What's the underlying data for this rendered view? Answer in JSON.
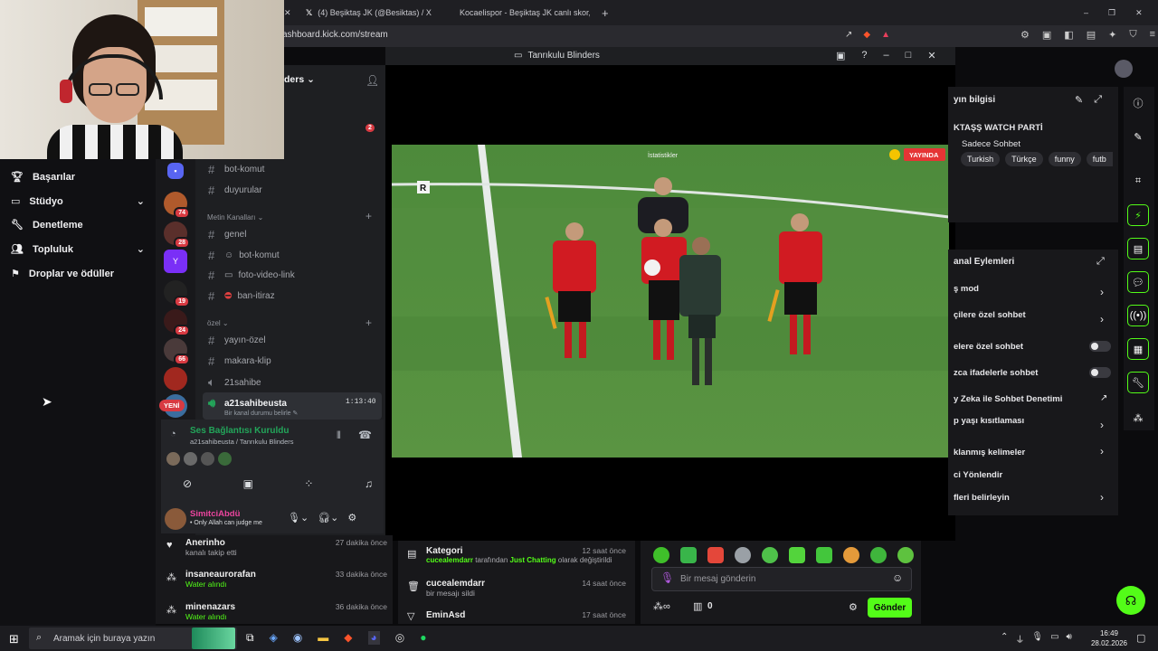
{
  "browser": {
    "tabs": [
      "(4) Beşiktaş JK (@Besiktas) / X",
      "Kocaelispor - Beşiktaş JK canlı skor, b"
    ],
    "url": "ashboard.kick.com/stream"
  },
  "kick_nav": [
    {
      "label": "Başarılar",
      "icon": "trophy-icon"
    },
    {
      "label": "Stüdyo",
      "icon": "studio-icon",
      "chevron": true
    },
    {
      "label": "Denetleme",
      "icon": "wrench-icon"
    },
    {
      "label": "Topluluk",
      "icon": "people-icon",
      "chevron": true
    },
    {
      "label": "Droplar ve ödüller",
      "icon": "rewards-icon"
    }
  ],
  "discord": {
    "server_title": "ders",
    "mention_badge": "2",
    "guild_badges": [
      "74",
      "28",
      "19",
      "24",
      "66"
    ],
    "new_label": "YENİ",
    "top_channels": [
      "bot-komut",
      "duyurular"
    ],
    "text_category": "Metin Kanalları",
    "text_channels": [
      "genel",
      "bot-komut",
      "foto-video-link",
      "ban-itiraz"
    ],
    "private_category": "özel",
    "private_channels": [
      "yayın-özel",
      "makara-klip",
      "21sahibe"
    ],
    "voice_channel": {
      "name": "a21sahibeusta",
      "time": "1:13:40",
      "status": "Bir kanal durumu belirle"
    },
    "voice_connected": "Ses Bağlantısı Kuruldu",
    "voice_path": "a21sahibeusta / Tanrıkulu Blinders",
    "user": {
      "name": "SimitciAbdü",
      "status": "Only Allah can judge me"
    }
  },
  "video": {
    "window_title": "Tanrıkulu Blinders",
    "live_label": "YAYINDA",
    "overlay_text": "İstatistikler",
    "r_logo": "R"
  },
  "stream_info": {
    "heading": "yın bilgisi",
    "title": "KTAŞŞ WATCH PARTİ",
    "chat_mode": "Sadece Sohbet",
    "tags": [
      "Turkish",
      "Türkçe",
      "funny",
      "futb"
    ]
  },
  "channel_actions": {
    "heading": "anal Eylemleri",
    "rows": [
      {
        "label": "ş mod",
        "control": "chevron"
      },
      {
        "label": "çilere özel sohbet",
        "control": "chevron"
      },
      {
        "label": "elere özel sohbet",
        "control": "toggle"
      },
      {
        "label": "zca ifadelerle sohbet",
        "control": "toggle"
      },
      {
        "label": "y Zeka ile Sohbet Denetimi",
        "control": "external"
      },
      {
        "label": "p yaşı kısıtlaması",
        "control": "chevron"
      },
      {
        "label": "klanmış kelimeler",
        "control": "chevron"
      },
      {
        "label": "ci Yönlendir",
        "control": "none"
      },
      {
        "label": "fleri belirleyin",
        "control": "chevron"
      }
    ]
  },
  "activity_feed": [
    {
      "name": "Anerinho",
      "desc": "kanalı takip etti",
      "time": "27 dakika önce"
    },
    {
      "name": "insaneaurorafan",
      "desc": "Water alındı",
      "time": "33 dakika önce"
    },
    {
      "name": "minenazars",
      "desc": "Water alındı",
      "time": "36 dakika önce"
    }
  ],
  "mod_log": [
    {
      "name": "Kategori",
      "actor": "cucealemdarr",
      "mid": "tarafından",
      "value": "Just Chatting",
      "end": "olarak değiştirildi",
      "time": "12 saat önce"
    },
    {
      "name": "cucealemdarr",
      "desc": "bir mesajı sildi",
      "time": "14 saat önce"
    },
    {
      "name": "EminAsd",
      "desc": "",
      "time": "17 saat önce"
    }
  ],
  "chat": {
    "placeholder": "Bir mesaj gönderin",
    "points": "0",
    "send_label": "Gönder"
  },
  "taskbar": {
    "search_placeholder": "Aramak için buraya yazın",
    "time": "16:49",
    "date": "28.02.2026"
  },
  "colors": {
    "kick_green": "#53fc18",
    "live_red": "#e53535",
    "discord_bg": "#1e1f22",
    "pitch": "#4f8a3c"
  }
}
